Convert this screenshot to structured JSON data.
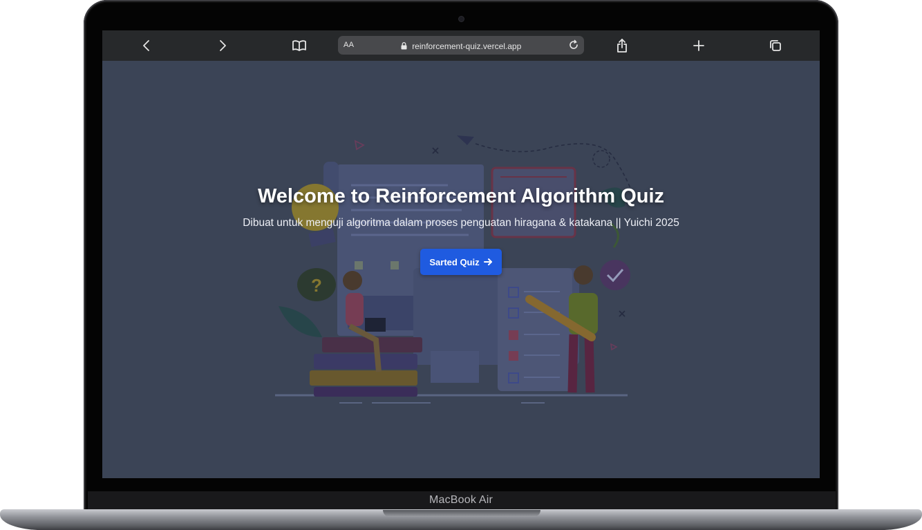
{
  "browser": {
    "text_size_label": "AA",
    "url": "reinforcement-quiz.vercel.app",
    "icons": [
      "back-icon",
      "forward-icon",
      "bookmarks-icon",
      "lock-icon",
      "reload-icon",
      "share-icon",
      "new-tab-icon",
      "tabs-icon"
    ]
  },
  "hero": {
    "title": "Welcome to Reinforcement Algorithm Quiz",
    "subtitle": "Dibuat untuk menguji algoritma dalam proses penguatan hiragana & katakana || Yuichi 2025",
    "start_label": "Sarted Quiz",
    "start_color": "#1f5be0"
  },
  "device": {
    "model": "MacBook Air"
  },
  "colors": {
    "page_background": "#3b4456",
    "toolbar": "#27292b"
  }
}
